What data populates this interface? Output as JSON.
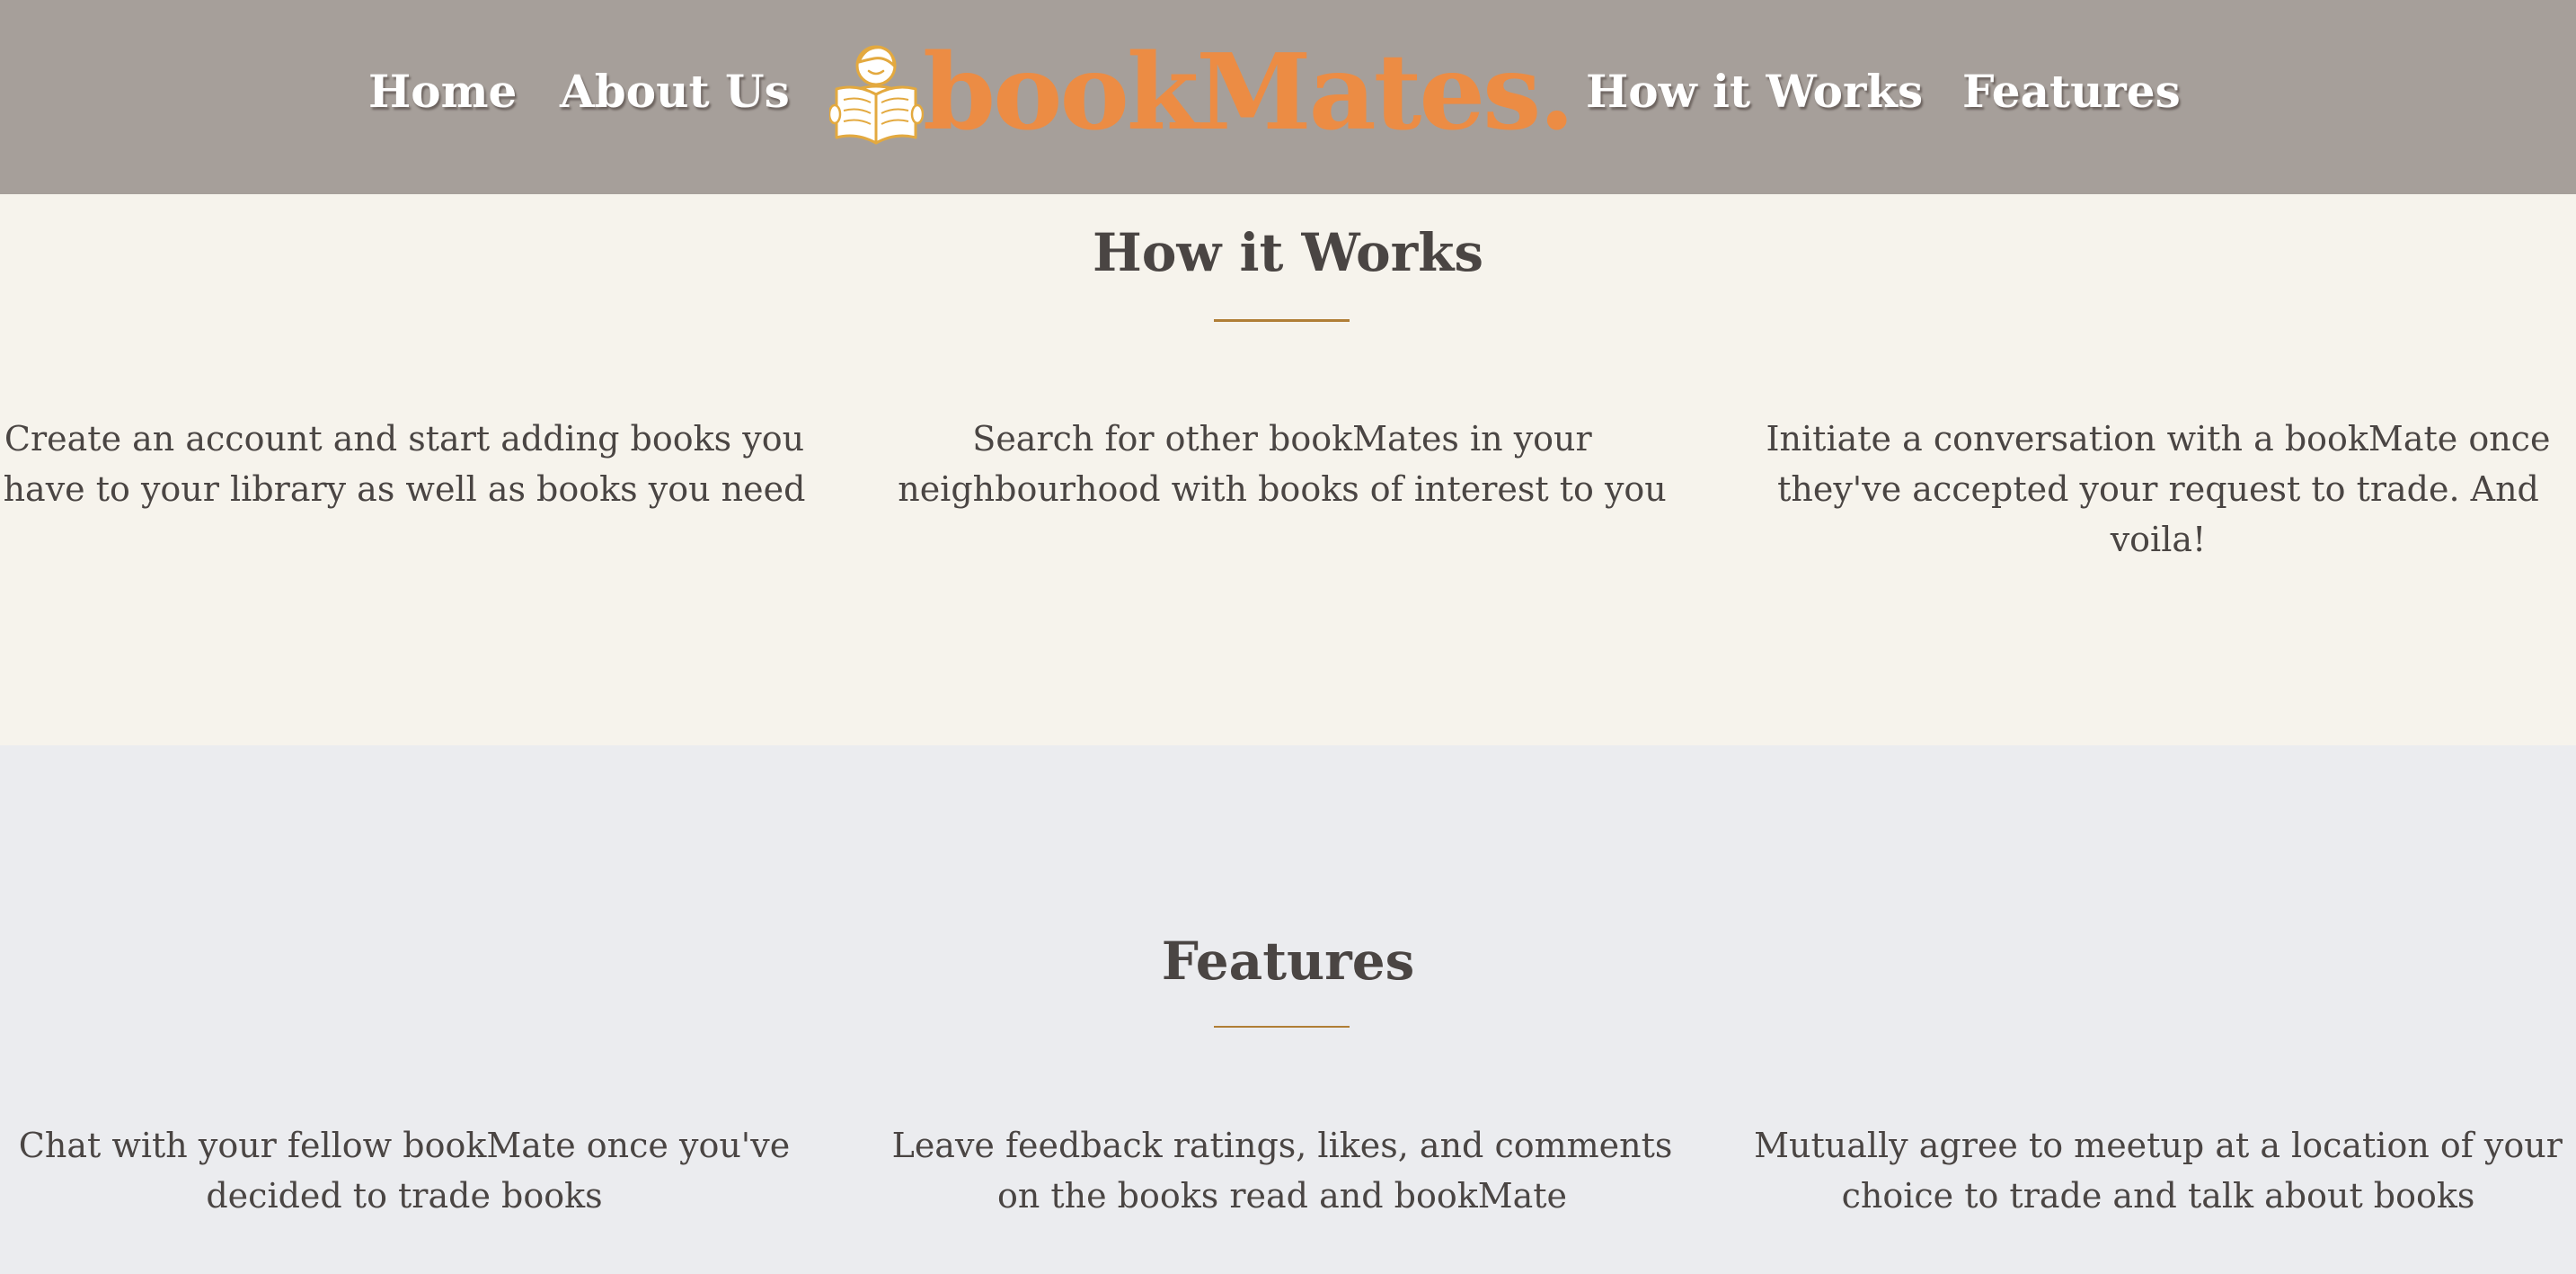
{
  "nav": {
    "home": "Home",
    "about": "About Us",
    "how": "How it Works",
    "features": "Features"
  },
  "logo": {
    "text": "bookMates.",
    "icon": "reading-person-icon"
  },
  "how_it_works": {
    "title": "How it Works",
    "columns": [
      "Create an account and start adding books you have to your library as well as books you need",
      "Search for other bookMates in your neighbourhood with books of interest to you",
      "Initiate a conversation with a bookMate once they've accepted your request to trade. And voila!"
    ]
  },
  "features": {
    "title": "Features",
    "columns": [
      "Chat with your fellow bookMate once you've decided to trade books",
      "Leave feedback ratings, likes, and comments on the books read and bookMate",
      "Mutually agree to meetup at a location of your choice to trade and talk about books"
    ]
  },
  "colors": {
    "header_bg": "#a69f9a",
    "brand_orange": "#ec8c44",
    "section_1_bg": "#f6f3ec",
    "section_2_bg": "#ebecef",
    "heading_text": "#4a4543",
    "accent_rule": "#b07e36"
  }
}
